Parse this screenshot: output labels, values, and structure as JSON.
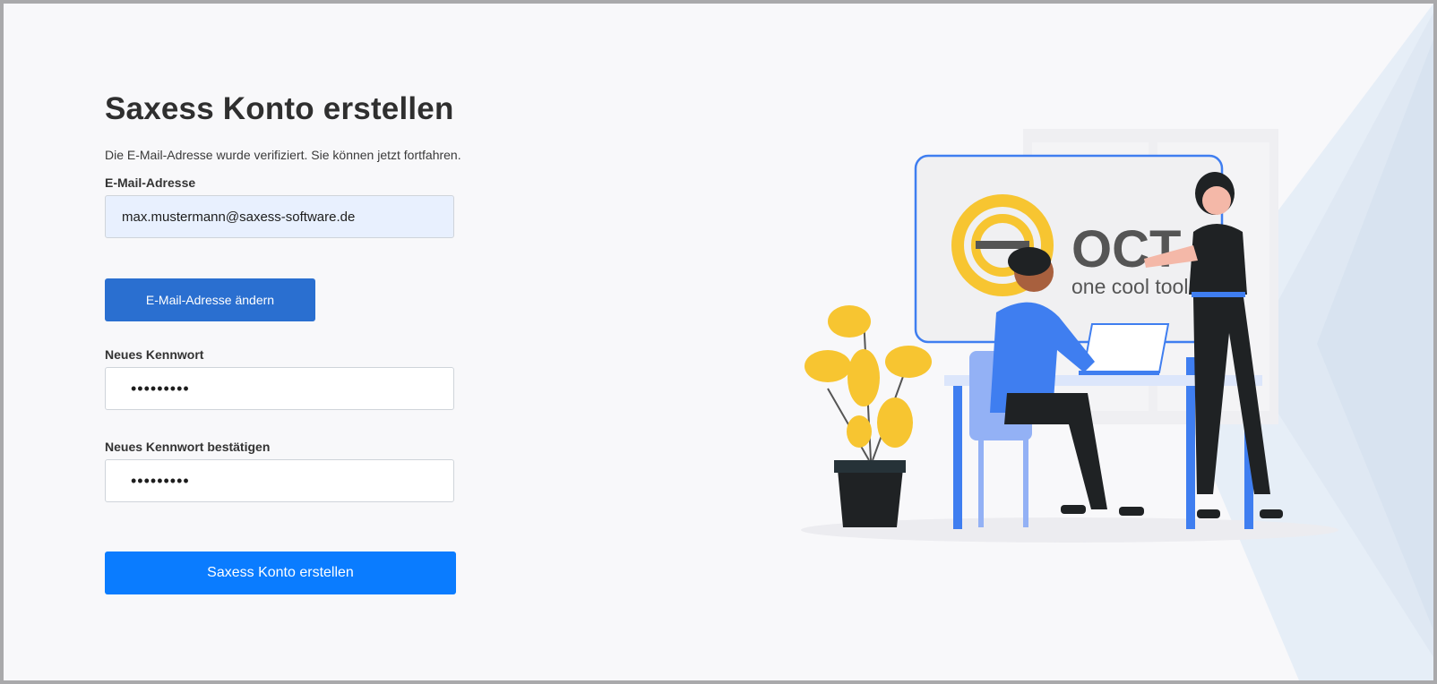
{
  "page": {
    "title": "Saxess Konto erstellen",
    "subtitle": "Die E-Mail-Adresse wurde verifiziert. Sie können jetzt fortfahren."
  },
  "form": {
    "email_label": "E-Mail-Adresse",
    "email_value": "max.mustermann@saxess-software.de",
    "change_email_button": "E-Mail-Adresse ändern",
    "password_label": "Neues Kennwort",
    "password_value": "•••••••••",
    "confirm_label": "Neues Kennwort bestätigen",
    "confirm_value": "•••••••••",
    "submit_button": "Saxess Konto erstellen"
  },
  "illustration": {
    "logo_letters": "OCT",
    "logo_tagline": "one cool tool"
  },
  "colors": {
    "primary": "#0a7cff",
    "secondary_button": "#2a6fd0",
    "email_fill": "#e8f0fe",
    "logo_yellow": "#f7c531",
    "figure_blue": "#3f7ef0"
  }
}
